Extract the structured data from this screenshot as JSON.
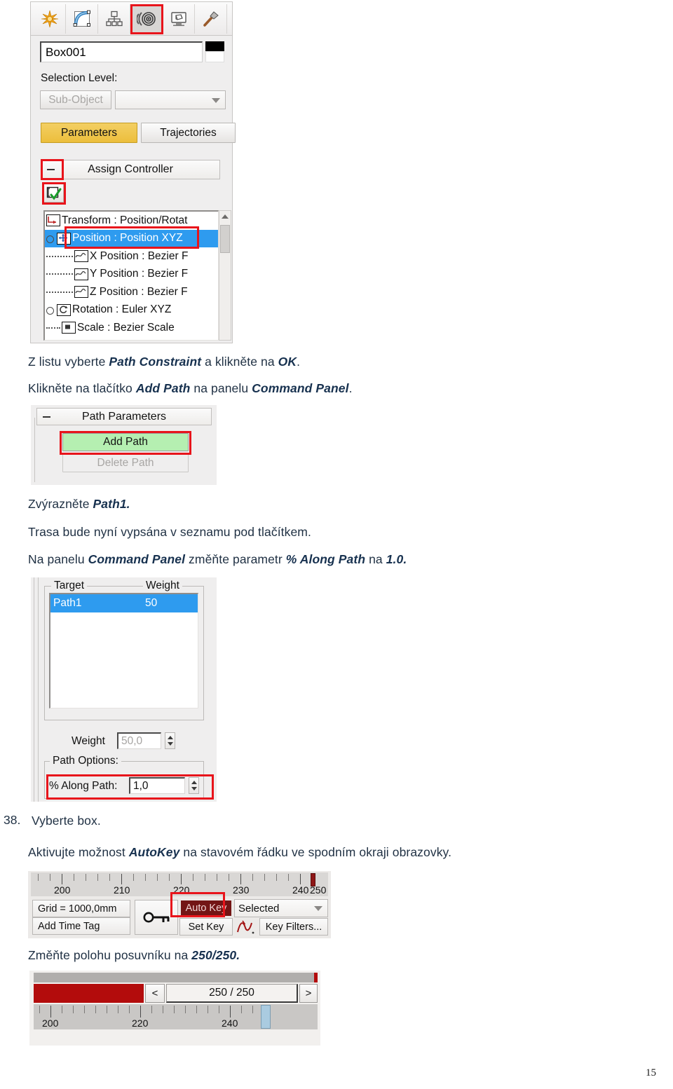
{
  "page": {
    "number": "15"
  },
  "panel_top": {
    "toolbar_icons": [
      "create-icon",
      "modify-icon",
      "hierarchy-icon",
      "motion-icon",
      "display-icon",
      "utilities-icon"
    ],
    "selected_icon": "motion-icon",
    "object_name": "Box001",
    "selection_level_label": "Selection Level:",
    "sub_object_button": "Sub-Object",
    "sub_object_dropdown_value": "",
    "tab_parameters": "Parameters",
    "tab_trajectories": "Trajectories",
    "rollout_assign_controller": "Assign Controller",
    "controller_tree": [
      {
        "label": "Transform : Position/Rotat",
        "icon": "transform-icon",
        "indent": 0,
        "selected": false,
        "dotted": false,
        "expander": false
      },
      {
        "label": "Position : Position XYZ",
        "icon": "position-icon",
        "indent": 1,
        "selected": true,
        "dotted": false,
        "expander": true
      },
      {
        "label": "X Position : Bezier F",
        "icon": "curve-icon",
        "indent": 2,
        "selected": false,
        "dotted": true,
        "expander": false
      },
      {
        "label": "Y Position : Bezier F",
        "icon": "curve-icon",
        "indent": 2,
        "selected": false,
        "dotted": true,
        "expander": false
      },
      {
        "label": "Z Position : Bezier F",
        "icon": "curve-icon",
        "indent": 2,
        "selected": false,
        "dotted": true,
        "expander": false
      },
      {
        "label": "Rotation : Euler XYZ",
        "icon": "rotation-icon",
        "indent": 1,
        "selected": false,
        "dotted": false,
        "expander": true
      },
      {
        "label": "Scale : Bezier Scale",
        "icon": "scale-icon",
        "indent": 1,
        "selected": false,
        "dotted": true,
        "expander": false
      }
    ]
  },
  "text": {
    "line1_a": "Z listu vyberte ",
    "line1_b": "Path Constraint",
    "line1_c": " a klikněte na ",
    "line1_d": "OK",
    "line1_e": ".",
    "line2_a": "Klikněte na tlačítko ",
    "line2_b": "Add Path",
    "line2_c": " na panelu ",
    "line2_d": "Command Panel",
    "line2_e": ".",
    "line3_a": "Zvýrazněte ",
    "line3_b": "Path1.",
    "line4": "Trasa bude nyní vypsána v seznamu pod tlačítkem.",
    "line5_a": "Na panelu ",
    "line5_b": "Command Panel",
    "line5_c": " změňte parametr ",
    "line5_d": "% Along Path",
    "line5_e": " na ",
    "line5_f": "1.0.",
    "step38_num": "38.",
    "step38_text": "Vyberte box.",
    "line6_a": "Aktivujte možnost ",
    "line6_b": "AutoKey",
    "line6_c": " na stavovém řádku ve spodním okraji obrazovky.",
    "line7_a": "Změňte polohu posuvníku na ",
    "line7_b": "250/250."
  },
  "panel_path_parameters": {
    "rollout_title": "Path Parameters",
    "add_path_button": "Add Path",
    "delete_path_button": "Delete Path"
  },
  "panel_target_weight": {
    "group_target_label": "Target",
    "group_weight_label": "Weight",
    "rows": [
      {
        "target": "Path1",
        "weight": "50",
        "selected": true
      }
    ],
    "weight_label": "Weight",
    "weight_value": "50,0",
    "path_options_label": "Path Options:",
    "along_path_label": "% Along Path:",
    "along_path_value": "1,0"
  },
  "status_bar": {
    "ruler_labels": [
      "200",
      "210",
      "220",
      "230",
      "240",
      "250"
    ],
    "grid_readout": "Grid = 1000,0mm",
    "add_time_tag": "Add Time Tag",
    "key_icon": "key-icon",
    "auto_key_button": "Auto Key",
    "set_key_button": "Set Key",
    "filter_combo_value": "Selected",
    "curve_icon": "key-curve-icon",
    "key_filters_button": "Key Filters..."
  },
  "time_slider": {
    "prev_button": "<",
    "next_button": ">",
    "readout": "250 / 250",
    "ruler_labels": [
      "200",
      "220",
      "240"
    ]
  },
  "colors": {
    "accent_red": "#e8141b",
    "selection_blue": "#2e9bef",
    "tab_yellow": "#ecbe3c",
    "add_path_green": "#b5efb1",
    "auto_key_red": "#731515",
    "track_red": "#b30c0c",
    "prose": "#1f3043"
  }
}
